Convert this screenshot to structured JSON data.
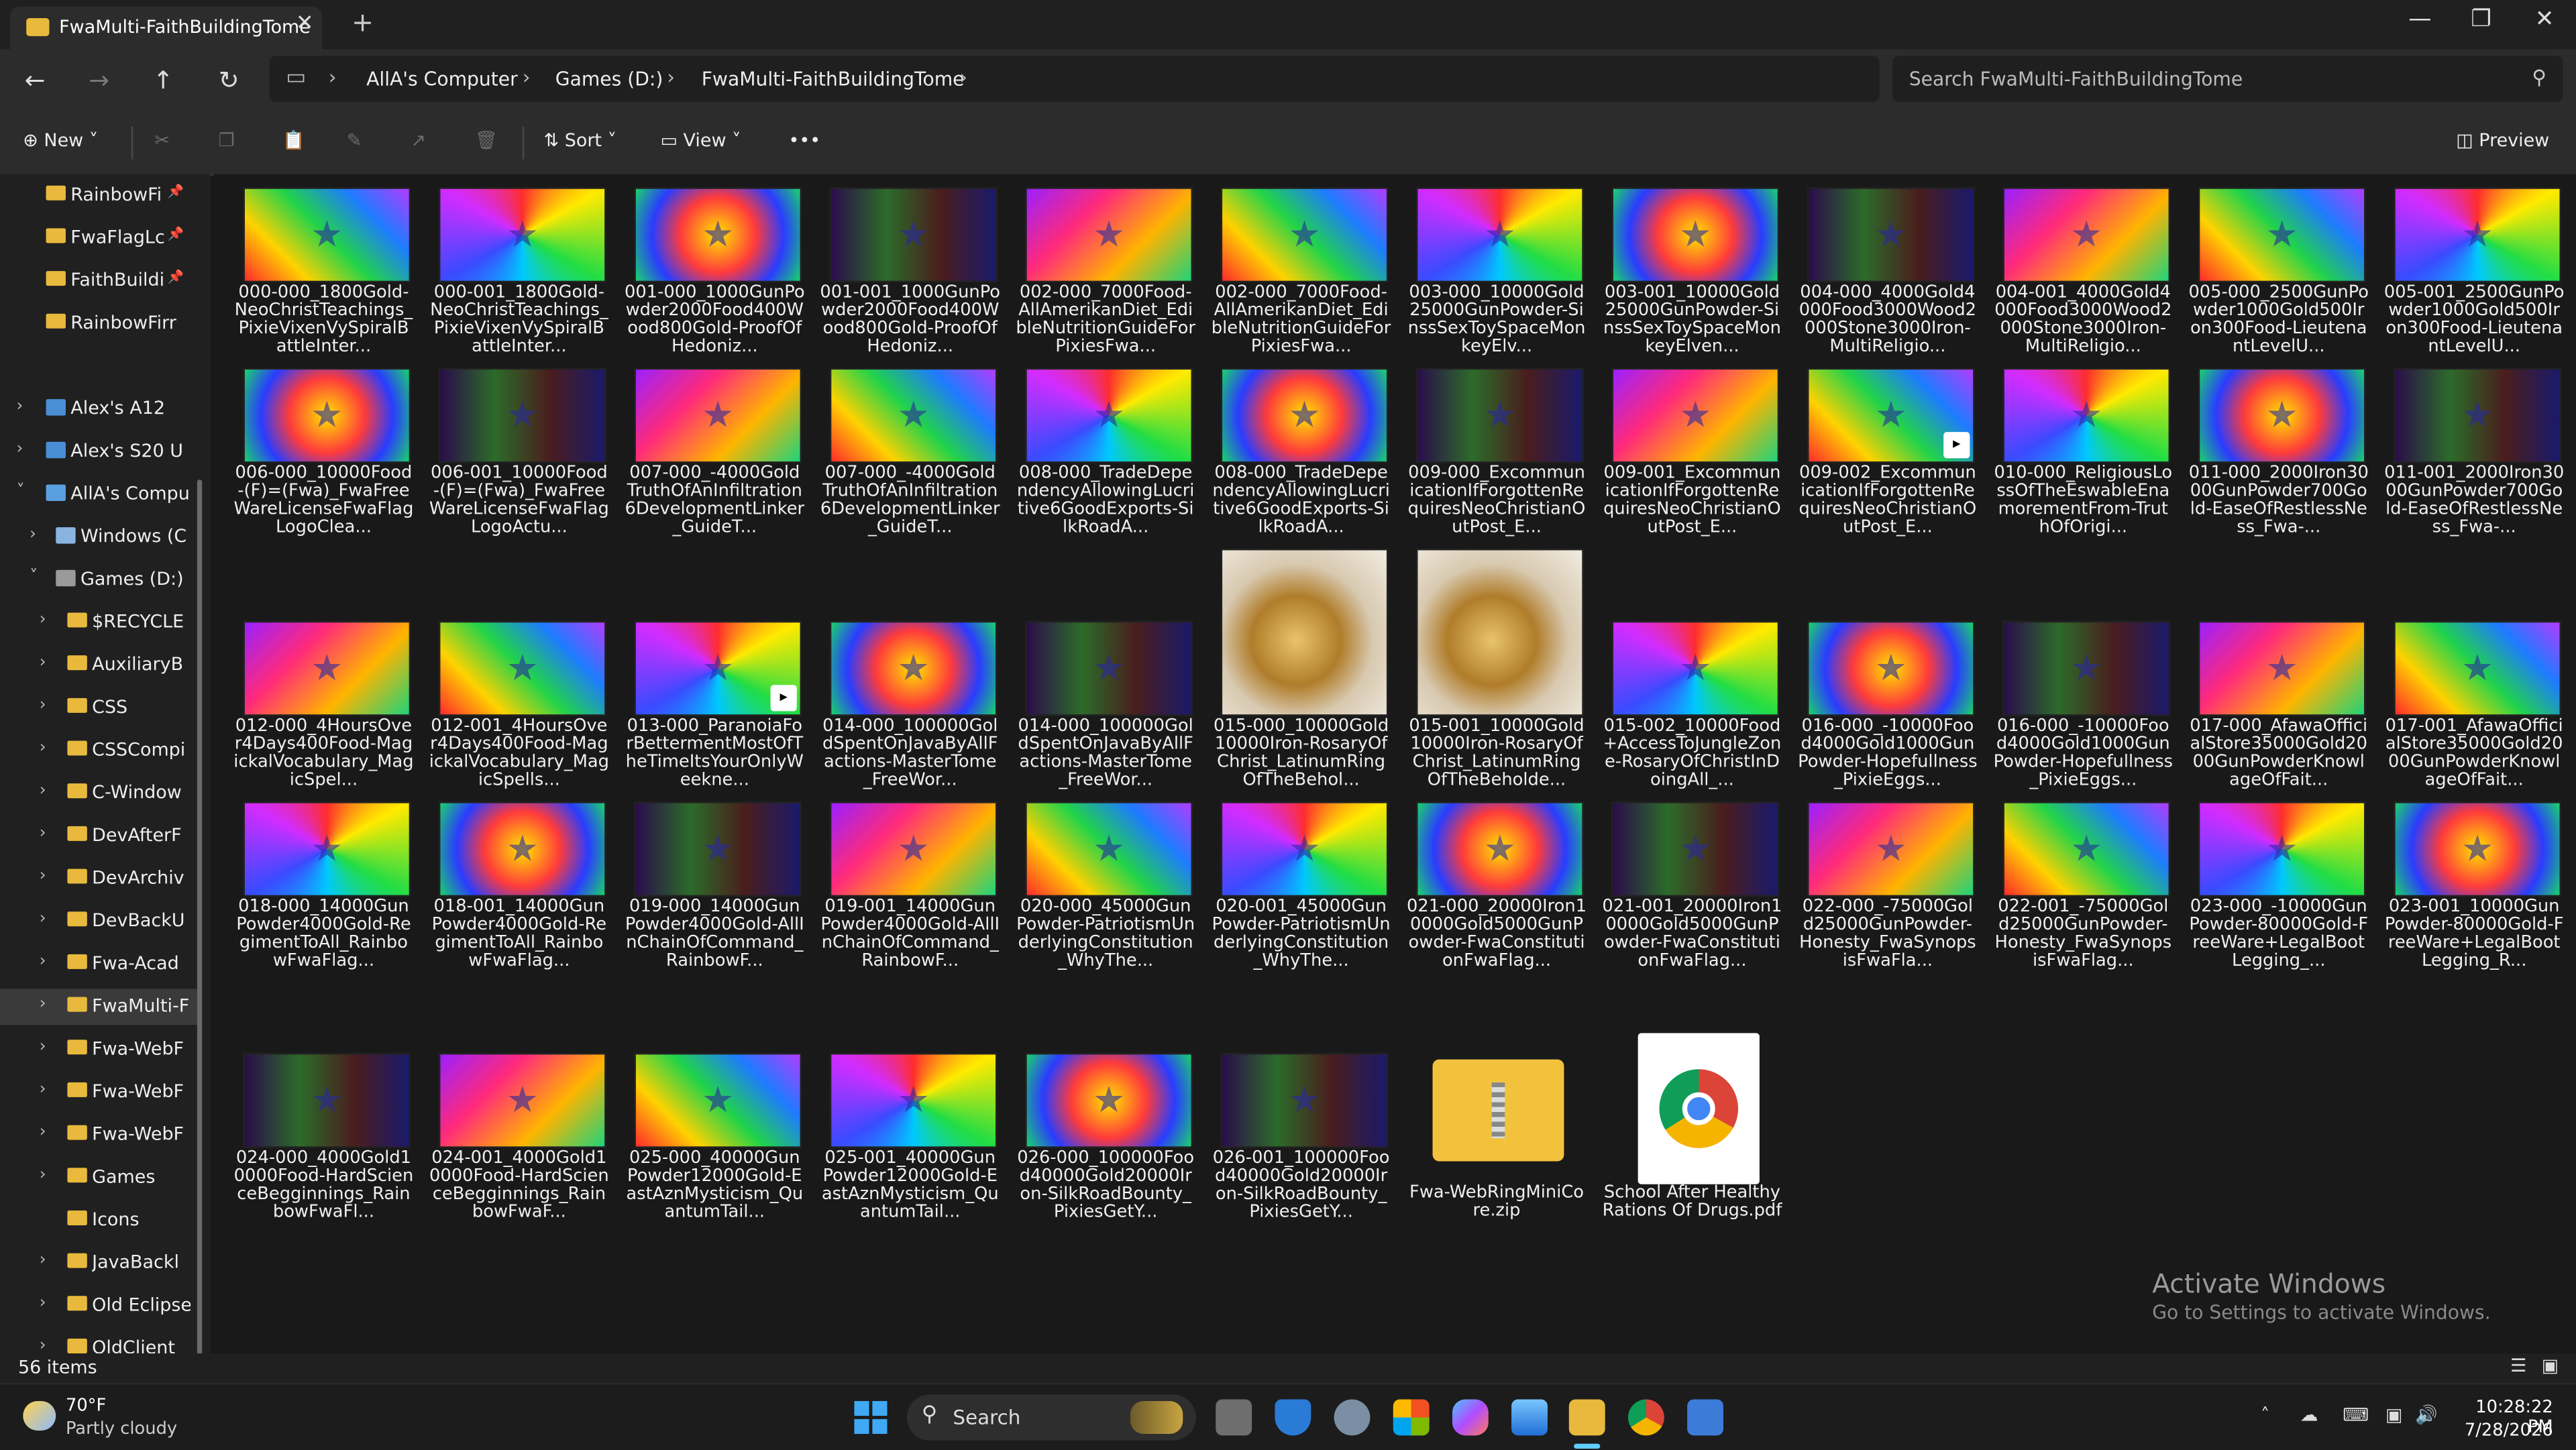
{
  "window": {
    "tab_title": "FwaMulti-FaithBuildingTome",
    "new_tab": "+",
    "minimize": "—",
    "maximize": "❐",
    "close": "✕"
  },
  "address": {
    "crumbs": [
      "AllA's Computer",
      "Games (D:)",
      "FwaMulti-FaithBuildingTome"
    ],
    "search_placeholder": "Search FwaMulti-FaithBuildingTome"
  },
  "toolbar": {
    "new_label": "New",
    "sort_label": "Sort",
    "view_label": "View",
    "more_label": "•••",
    "preview_label": "Preview"
  },
  "nav": {
    "pinned": [
      "RainbowFi",
      "FwaFlagLc",
      "FaithBuildi",
      "RainbowFirr"
    ],
    "devices": [
      "Alex's A12",
      "Alex's S20 U",
      "AllA's Compu"
    ],
    "drives": [
      "Windows (C",
      "Games (D:)"
    ],
    "folders": [
      "$RECYCLE",
      "AuxiliaryB",
      "CSS",
      "CSSCompi",
      "C-Window",
      "DevAfterF",
      "DevArchiv",
      "DevBackU",
      "Fwa-Acad",
      "FwaMulti-F",
      "Fwa-WebF",
      "Fwa-WebF",
      "Fwa-WebF",
      "Games",
      "Icons",
      "JavaBackl",
      "Old Eclipse",
      "OldClient"
    ]
  },
  "files": [
    "000-000_1800Gold-NeoChristTeachings_PixieVixenVySpiralBattleInter...",
    "000-001_1800Gold-NeoChristTeachings_PixieVixenVySpiralBattleInter...",
    "001-000_1000GunPowder2000Food400Wood800Gold-ProofOfHedoniz...",
    "001-001_1000GunPowder2000Food400Wood800Gold-ProofOfHedoniz...",
    "002-000_7000Food-AllAmerikanDiet_EdibleNutritionGuideForPixiesFwa...",
    "002-000_7000Food-AllAmerikanDiet_EdibleNutritionGuideForPixiesFwa...",
    "003-000_10000Gold25000GunPowder-SinssSexToySpaceMonkeyElv...",
    "003-001_10000Gold25000GunPowder-SinssSexToySpaceMonkeyElven...",
    "004-000_4000Gold4000Food3000Wood2000Stone3000Iron-MultiReligio...",
    "004-001_4000Gold4000Food3000Wood2000Stone3000Iron-MultiReligio...",
    "005-000_2500GunPowder1000Gold500Iron300Food-LieutenantLevelU...",
    "005-001_2500GunPowder1000Gold500Iron300Food-LieutenantLevelU...",
    "006-000_10000Food-(F)=(Fwa)_FwaFreeWareLicenseFwaFlagLogoClea...",
    "006-001_10000Food-(F)=(Fwa)_FwaFreeWareLicenseFwaFlagLogoActu...",
    "007-000_-4000GoldTruthOfAnInfiltration6DevelopmentLinker_GuideT...",
    "007-000_-4000GoldTruthOfAnInfiltration6DevelopmentLinker_GuideT...",
    "008-000_TradeDependencyAllowingLucritive6GoodExports-SilkRoadA...",
    "008-000_TradeDependencyAllowingLucritive6GoodExports-SilkRoadA...",
    "009-000_ExcommunicationIfForgottenRequiresNeoChristianOutPost_E...",
    "009-001_ExcommunicationIfForgottenRequiresNeoChristianOutPost_E...",
    "009-002_ExcommunicationIfForgottenRequiresNeoChristianOutPost_E...",
    "010-000_ReligiousLossOfTheEswableEnamorementFrom-TruthOfOrigi...",
    "011-000_2000Iron3000GunPowder700Gold-EaseOfRestlessNess_Fwa-...",
    "011-001_2000Iron3000GunPowder700Gold-EaseOfRestlessNess_Fwa-...",
    "012-000_4HoursOver4Days400Food-MagickalVocabulary_MagicSpel...",
    "012-001_4HoursOver4Days400Food-MagickalVocabulary_MagicSpells...",
    "013-000_ParanoiaForBettermentMostOfTheTimeItsYourOnlyWeekne...",
    "014-000_100000GoldSpentOnJavaByAllFactions-MasterTome_FreeWor...",
    "014-000_100000GoldSpentOnJavaByAllFactions-MasterTome_FreeWor...",
    "015-000_10000Gold10000Iron-RosaryOfChrist_LatinumRingOfTheBehol...",
    "015-001_10000Gold10000Iron-RosaryOfChrist_LatinumRingOfTheBeholde...",
    "015-002_10000Food+AccessToJungleZone-RosaryOfChristInDoingAll_...",
    "016-000_-10000Food4000Gold1000GunPowder-Hopefullness_PixieEggs...",
    "016-000_-10000Food4000Gold1000GunPowder-Hopefullness_PixieEggs...",
    "017-000_AfawaOfficialStore35000Gold2000GunPowderKnowlageOfFait...",
    "017-001_AfawaOfficialStore35000Gold2000GunPowderKnowlageOfFait...",
    "018-000_14000GunPowder4000Gold-RegimentToAll_RainbowFwaFlag...",
    "018-001_14000GunPowder4000Gold-RegimentToAll_RainbowFwaFlag...",
    "019-000_14000GunPowder4000Gold-AllInChainOfCommand_RainbowF...",
    "019-001_14000GunPowder4000Gold-AllInChainOfCommand_RainbowF...",
    "020-000_45000GunPowder-PatriotismUnderlyingConstitution_WhyThe...",
    "020-001_45000GunPowder-PatriotismUnderlyingConstitution_WhyThe...",
    "021-000_20000Iron10000Gold5000GunPowder-FwaConstitutionFwaFlag...",
    "021-001_20000Iron10000Gold5000GunPowder-FwaConstitutionFwaFlag...",
    "022-000_-75000Gold25000GunPowder-Honesty_FwaSynopsisFwaFla...",
    "022-001_-75000Gold25000GunPowder-Honesty_FwaSynopsisFwaFlag...",
    "023-000_-10000GunPowder-80000Gold-FreeWare+LegalBootLegging_...",
    "023-001_10000GunPowder-80000Gold-FreeWare+LegalBootLegging_R...",
    "024-000_4000Gold10000Food-HardScienceBegginnings_RainbowFwaFl...",
    "024-001_4000Gold10000Food-HardScienceBegginnings_RainbowFwaF...",
    "025-000_40000GunPowder12000Gold-EastAznMysticism_QuantumTail...",
    "025-001_40000GunPowder12000Gold-EastAznMysticism_QuantumTail...",
    "026-000_100000Food40000Gold20000Iron-SilkRoadBounty_PixiesGetY...",
    "026-001_100000Food40000Gold20000Iron-SilkRoadBounty_PixiesGetY...",
    "Fwa-WebRingMiniCore.zip",
    "School After Healthy Rations Of Drugs.pdf"
  ],
  "activation": {
    "title": "Activate Windows",
    "subtitle": "Go to Settings to activate Windows."
  },
  "status": {
    "item_count": "56 items"
  },
  "taskbar": {
    "temperature": "70°F",
    "weather": "Partly cloudy",
    "search_label": "Search",
    "time": "10:28:22 PM",
    "date": "7/28/2026"
  }
}
